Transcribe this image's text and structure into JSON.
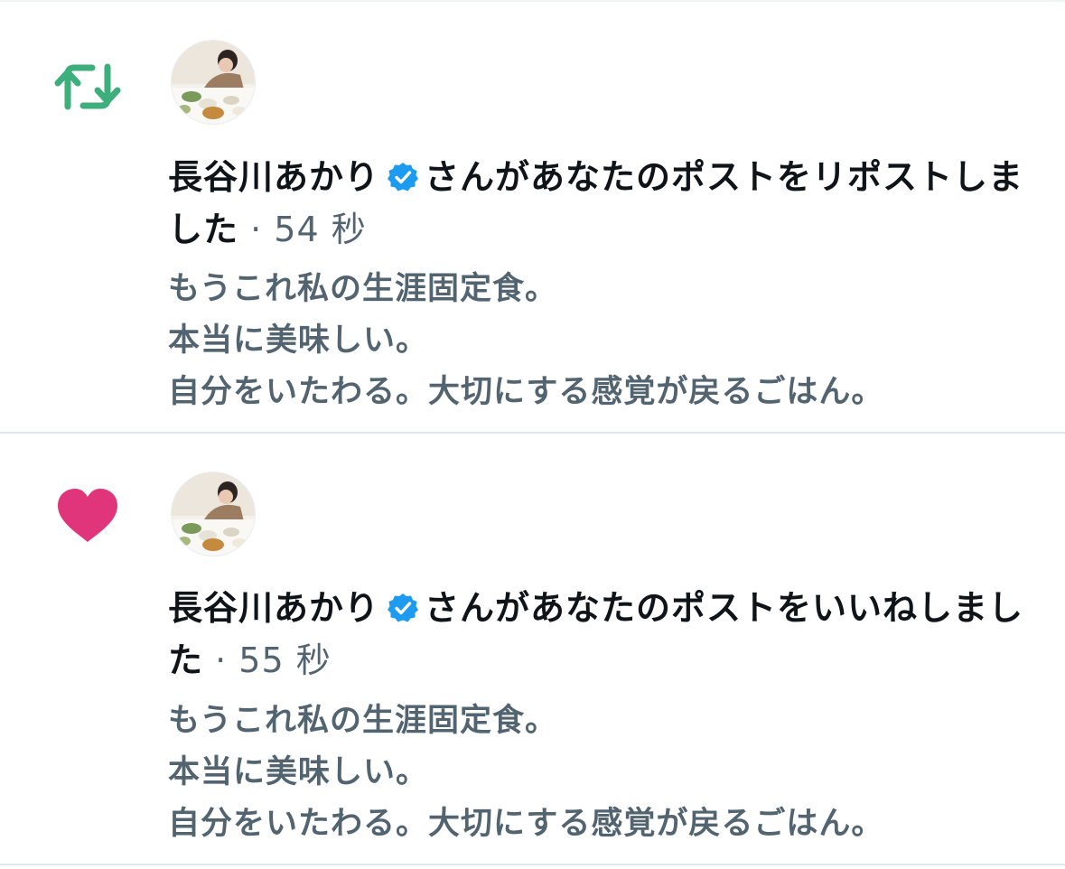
{
  "notifications": [
    {
      "type": "repost",
      "type_icon": "repost-icon",
      "type_color": "#3daf7c",
      "avatar_icon": "user-avatar",
      "user_name": "長谷川あかり",
      "verified_icon": "verified-badge-icon",
      "action_text": "さんがあなたのポストをリポストしました",
      "separator": "·",
      "time": "54 秒",
      "post_lines": [
        "もうこれ私の生涯固定食。",
        "本当に美味しい。",
        "自分をいたわる。大切にする感覚が戻るごはん。"
      ]
    },
    {
      "type": "like",
      "type_icon": "heart-icon",
      "type_color": "#e0357a",
      "avatar_icon": "user-avatar",
      "user_name": "長谷川あかり",
      "verified_icon": "verified-badge-icon",
      "action_text": "さんがあなたのポストをいいねしました",
      "separator": "·",
      "time": "55 秒",
      "post_lines": [
        "もうこれ私の生涯固定食。",
        "本当に美味しい。",
        "自分をいたわる。大切にする感覚が戻るごはん。"
      ]
    }
  ],
  "colors": {
    "verified_blue": "#1d9bf0",
    "text_primary": "#0f1419",
    "text_secondary": "#536471",
    "divider": "#e1e8ed"
  }
}
